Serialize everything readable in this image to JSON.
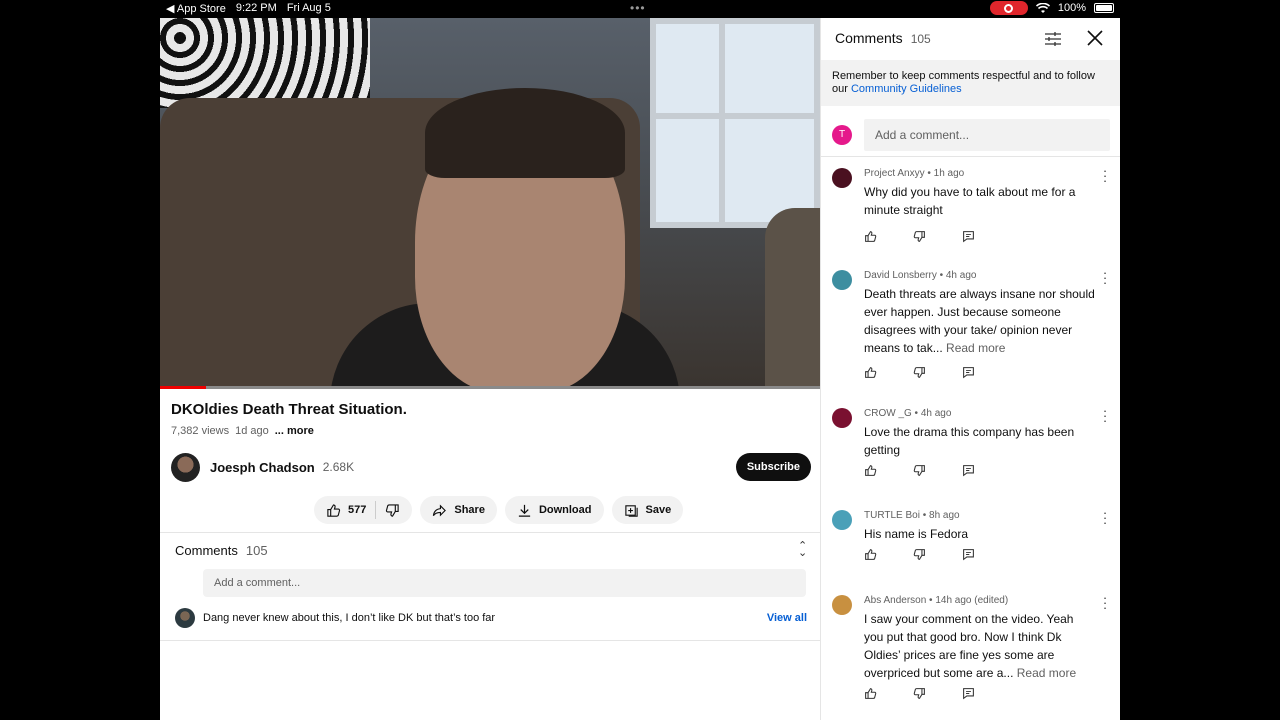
{
  "status_bar": {
    "back_app": "◀ App Store",
    "time": "9:22 PM",
    "date": "Fri Aug 5",
    "battery": "100%"
  },
  "video": {
    "title": "DKOldies Death Threat Situation.",
    "views": "7,382 views",
    "age": "1d ago",
    "more": "... more",
    "progress_fraction": 0.07
  },
  "channel": {
    "name": "Joesph Chadson",
    "subscribers": "2.68K",
    "subscribe_label": "Subscribe"
  },
  "actions": {
    "likes": "577",
    "share": "Share",
    "download": "Download",
    "save": "Save"
  },
  "comments_section": {
    "label": "Comments",
    "count": "105",
    "placeholder": "Add a comment...",
    "preview_text": "Dang never knew about this, I don’t like DK but that’s too far",
    "view_all": "View all"
  },
  "panel": {
    "title": "Comments",
    "count": "105",
    "notice": "Remember to keep comments respectful and to follow our",
    "notice_link": "Community Guidelines",
    "user_initial": "T",
    "placeholder": "Add a comment...",
    "comments": [
      {
        "author": "Project Anxyy",
        "age": "1h ago",
        "text": "Why did you have to talk about me for a minute straight",
        "read_more": "",
        "avatar_color": "#4a1020"
      },
      {
        "author": "David Lonsberry",
        "age": "4h ago",
        "text": "Death threats are always insane nor should ever happen. Just because someone disagrees with your take/ opinion never means to tak...",
        "read_more": "Read more",
        "avatar_color": "#3d8ea0"
      },
      {
        "author": "CROW _G",
        "age": "4h ago",
        "text": "Love the drama this company has been getting",
        "read_more": "",
        "avatar_color": "#7a1030"
      },
      {
        "author": "TURTLE Boi",
        "age": "8h ago",
        "text": "His name is Fedora",
        "read_more": "",
        "avatar_color": "#4aa0b8"
      },
      {
        "author": "Abs Anderson",
        "age": "14h ago (edited)",
        "text": "I saw your comment on the video. Yeah you put that good bro. Now I think Dk Oldies’ prices are fine yes some are overpriced but some are a...",
        "read_more": "Read more",
        "avatar_color": "#c89040"
      }
    ]
  }
}
